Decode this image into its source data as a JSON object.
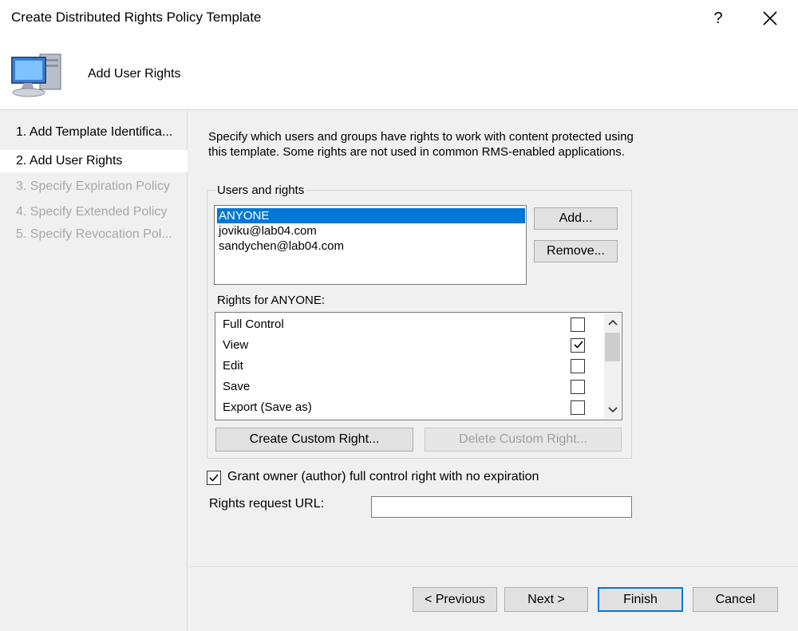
{
  "window": {
    "title": "Create Distributed Rights Policy Template",
    "help_label": "?",
    "close_icon": "close-icon"
  },
  "header": {
    "icon": "computer-icon",
    "title": "Add User Rights"
  },
  "nav": {
    "items": [
      {
        "label": "1. Add Template Identifica...",
        "state": "normal"
      },
      {
        "label": "2. Add User Rights",
        "state": "active"
      },
      {
        "label": "3. Specify Expiration Policy",
        "state": "disabled"
      },
      {
        "label": "4. Specify Extended Policy",
        "state": "disabled"
      },
      {
        "label": "5. Specify Revocation Pol...",
        "state": "disabled"
      }
    ]
  },
  "main": {
    "description": "Specify which users and groups have rights to work with content protected using this template. Some rights are not used in common RMS-enabled applications.",
    "users_group_label": "Users and rights",
    "users": [
      {
        "name": "ANYONE",
        "selected": true
      },
      {
        "name": "joviku@lab04.com",
        "selected": false
      },
      {
        "name": "sandychen@lab04.com",
        "selected": false
      }
    ],
    "add_button": "Add...",
    "remove_button": "Remove...",
    "rights_label": "Rights for ANYONE:",
    "rights": [
      {
        "name": "Full Control",
        "checked": false
      },
      {
        "name": "View",
        "checked": true
      },
      {
        "name": "Edit",
        "checked": false
      },
      {
        "name": "Save",
        "checked": false
      },
      {
        "name": "Export (Save as)",
        "checked": false
      }
    ],
    "create_custom_right_button": "Create Custom Right...",
    "delete_custom_right_button": "Delete Custom Right...",
    "grant_owner_label": "Grant owner (author) full control right with no expiration",
    "grant_owner_checked": true,
    "rights_request_url_label": "Rights request URL:",
    "rights_request_url_value": ""
  },
  "footer": {
    "previous_button": "< Previous",
    "next_button": "Next >",
    "finish_button": "Finish",
    "cancel_button": "Cancel"
  },
  "colors": {
    "selection": "#0078d7",
    "default_button_border": "#0078d7",
    "disabled_text": "#a8a8a8"
  }
}
